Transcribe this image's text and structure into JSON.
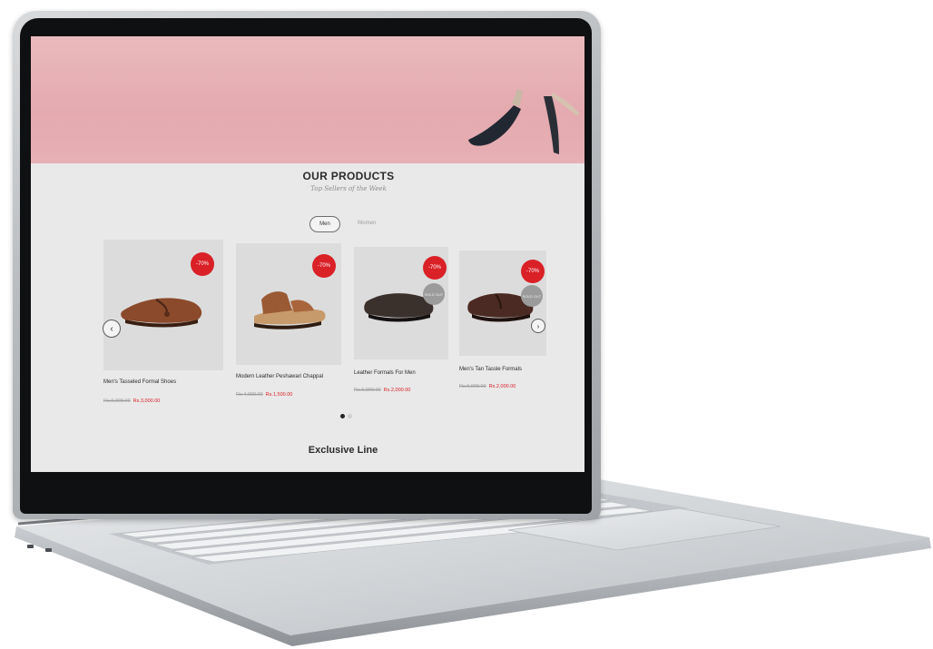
{
  "page": {
    "section_title": "OUR PRODUCTS",
    "section_subtitle": "Top Sellers of the Week",
    "next_section_title": "Exclusive Line"
  },
  "tabs": [
    {
      "label": "Men",
      "active": true
    },
    {
      "label": "Women",
      "active": false
    }
  ],
  "products": [
    {
      "name": "Men's Tasseled Formal Shoes",
      "old_price": "Rs.9,999.00",
      "new_price": "Rs.3,000.00",
      "discount": "-70%",
      "sold_out": null
    },
    {
      "name": "Modern Leather Peshawari Chappal",
      "old_price": "Rs.4,999.00",
      "new_price": "Rs.1,500.00",
      "discount": "-70%",
      "sold_out": null
    },
    {
      "name": "Leather Formals For Men",
      "old_price": "Rs.6,999.00",
      "new_price": "Rs.2,000.00",
      "discount": "-70%",
      "sold_out": "SOLD OUT"
    },
    {
      "name": "Men's Tan Tassle Formals",
      "old_price": "Rs.6,999.00",
      "new_price": "Rs.2,000.00",
      "discount": "-70%",
      "sold_out": "SOLD OUT"
    }
  ],
  "carousel": {
    "prev_icon": "chevron-left-icon",
    "next_icon": "chevron-right-icon",
    "prev_glyph": "‹",
    "next_glyph": "›",
    "pages": 2,
    "active_page": 1
  },
  "colors": {
    "accent_red": "#d92127",
    "hero_pink": "#e4aaaf",
    "page_bg": "#e9e9e9"
  }
}
